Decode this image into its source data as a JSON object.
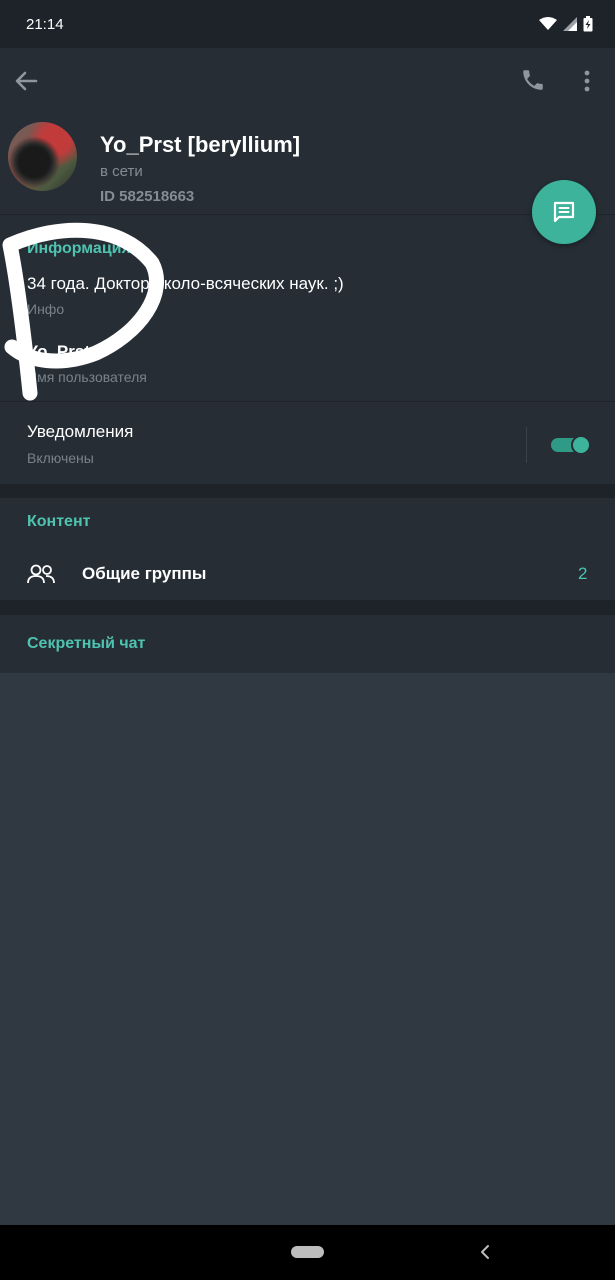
{
  "status_bar": {
    "time": "21:14",
    "icons": [
      "wifi-icon",
      "cell-signal-icon",
      "battery-charging-icon"
    ]
  },
  "app_bar": {
    "icons": [
      "back-arrow-icon",
      "phone-icon",
      "more-vert-icon"
    ]
  },
  "profile": {
    "name": "Yo_Prst [beryllium]",
    "status": "в сети",
    "id": "ID 582518663"
  },
  "info": {
    "title": "Информация",
    "bio": "34 года. Доктор около-всяческих наук. ;)",
    "bio_label": "Инфо",
    "username": "Yo_Prst",
    "username_label": "Имя пользователя",
    "notifications": "Уведомления",
    "notifications_status": "Включены",
    "notifications_enabled": true
  },
  "content": {
    "title": "Контент",
    "groups_label": "Общие группы",
    "groups_count": "2"
  },
  "secret_chat": {
    "label": "Секретный чат"
  },
  "colors": {
    "accent": "#4fc3b0",
    "fab": "#3eb39c",
    "background": "#303942",
    "surface": "#262d35",
    "scribble": "#ffffff"
  }
}
